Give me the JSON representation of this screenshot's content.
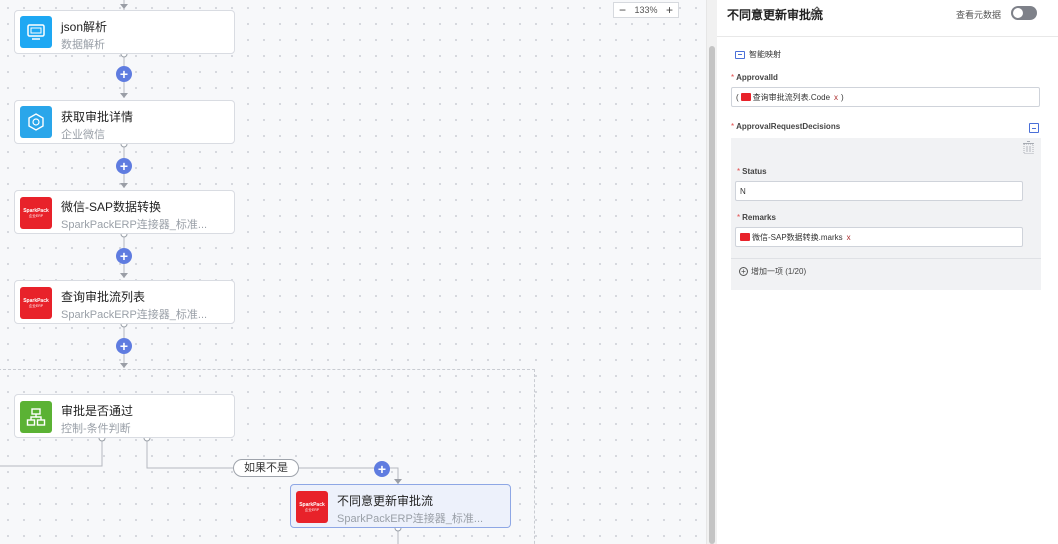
{
  "canvas": {
    "zoom": {
      "minus": "−",
      "level": "133%",
      "plus": "+"
    },
    "nodes": [
      {
        "title": "json解析",
        "subtitle": "数据解析",
        "icon": "monitor-icon"
      },
      {
        "title": "获取审批详情",
        "subtitle": "企业微信",
        "icon": "wecom-icon"
      },
      {
        "title": "微信-SAP数据转换",
        "subtitle": "SparkPackERP连接器_标准...",
        "icon": "sparkpack-icon"
      },
      {
        "title": "查询审批流列表",
        "subtitle": "SparkPackERP连接器_标准...",
        "icon": "sparkpack-icon"
      },
      {
        "title": "审批是否通过",
        "subtitle": "控制-条件判断",
        "icon": "flowchart-icon"
      },
      {
        "title": "不同意更新审批流",
        "subtitle": "SparkPackERP连接器_标准...",
        "icon": "sparkpack-icon"
      }
    ],
    "sparkpack_logo": {
      "line1": "SparkPack",
      "line2": "企业ERP"
    },
    "branch_label": "如果不是",
    "add_symbol": "+"
  },
  "panel": {
    "title": "不同意更新审批流",
    "meta_toggle_label": "查看元数据",
    "smart_mapping": "智能映射",
    "fields": {
      "approval_id": {
        "label": "ApprovalId",
        "open": "(",
        "tag": "查询审批流列表.Code",
        "tag_remove": "x",
        "close": ")"
      },
      "decisions": {
        "label": "ApprovalRequestDecisions"
      },
      "status": {
        "label": "Status",
        "value": "N"
      },
      "remarks": {
        "label": "Remarks",
        "tag": "微信-SAP数据转换.marks",
        "tag_remove": "x"
      }
    },
    "required_mark": "*",
    "add_item": "增加一项 (1/20)"
  },
  "colors": {
    "accent": "#5f7ce0",
    "sparkpack_red": "#e8222a",
    "selected_bg": "#edf1fb"
  }
}
